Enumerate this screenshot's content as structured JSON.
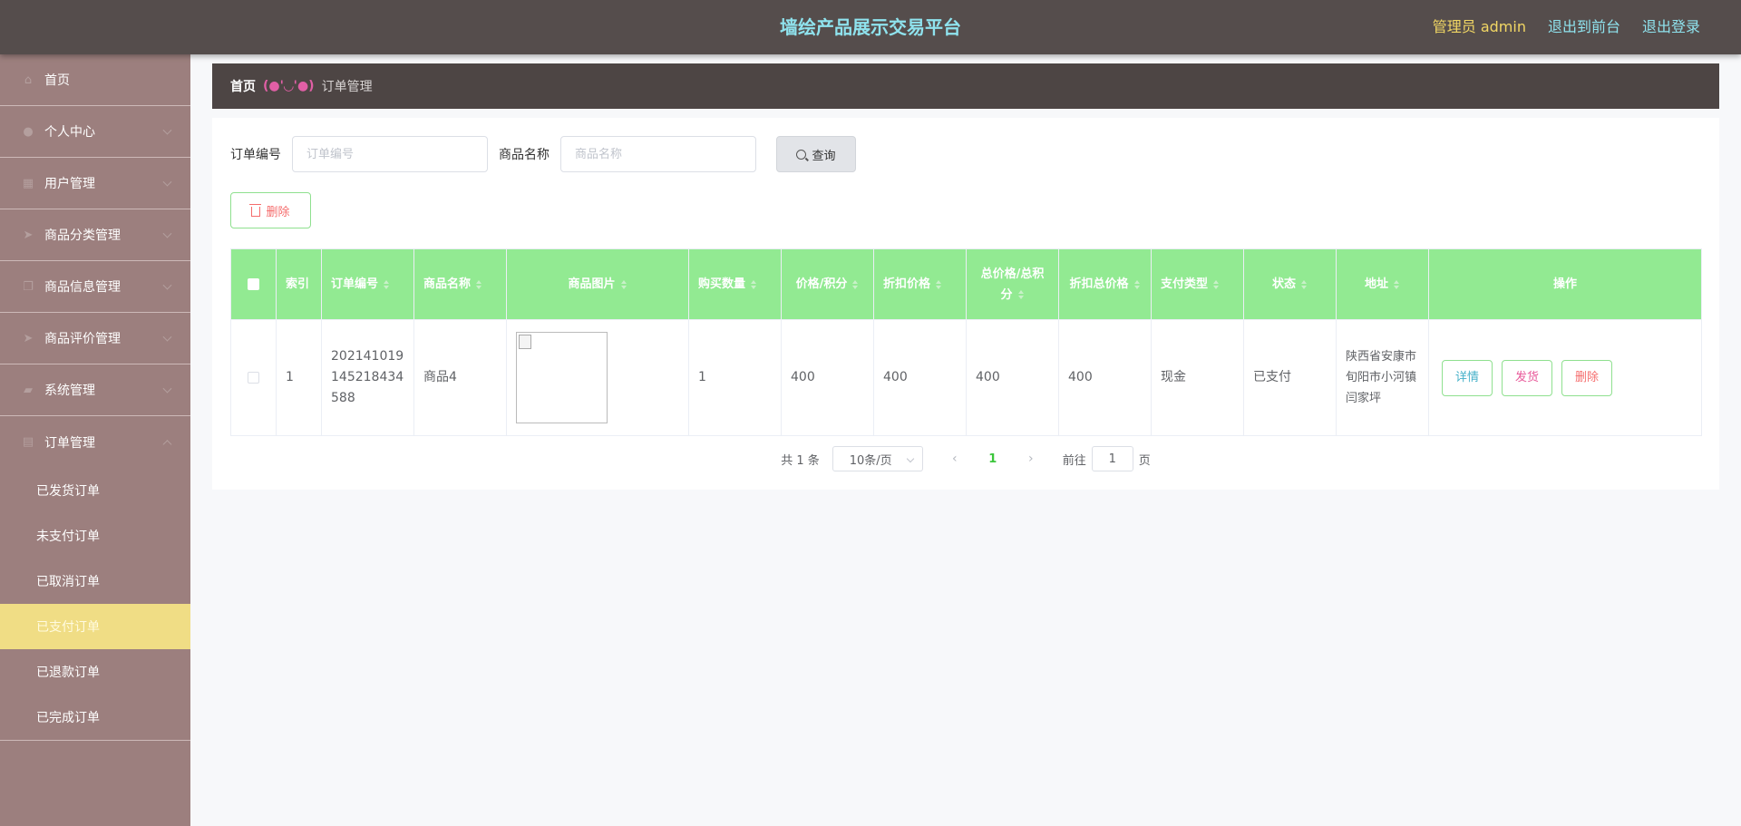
{
  "header": {
    "title": "墙绘产品展示交易平台",
    "admin_label": "管理员 admin",
    "to_front": "退出到前台",
    "logout": "退出登录"
  },
  "sidebar": {
    "items": [
      {
        "label": "首页",
        "icon": "home-icon"
      },
      {
        "label": "个人中心",
        "icon": "user-icon"
      },
      {
        "label": "用户管理",
        "icon": "grid-icon"
      },
      {
        "label": "商品分类管理",
        "icon": "send-icon"
      },
      {
        "label": "商品信息管理",
        "icon": "copy-icon"
      },
      {
        "label": "商品评价管理",
        "icon": "send-icon"
      },
      {
        "label": "系统管理",
        "icon": "truck-icon"
      },
      {
        "label": "订单管理",
        "icon": "cart-icon"
      }
    ],
    "sub_items": [
      "已发货订单",
      "未支付订单",
      "已取消订单",
      "已支付订单",
      "已退款订单",
      "已完成订单"
    ],
    "active_sub": "已支付订单"
  },
  "breadcrumb": {
    "home": "首页",
    "face": "(●'◡'●)",
    "current": "订单管理"
  },
  "search": {
    "order_no_label": "订单编号",
    "order_no_placeholder": "订单编号",
    "product_label": "商品名称",
    "product_placeholder": "商品名称",
    "query_button": "查询"
  },
  "toolbar": {
    "delete_button": "删除"
  },
  "table": {
    "headers": [
      "索引",
      "订单编号",
      "商品名称",
      "商品图片",
      "购买数量",
      "价格/积分",
      "折扣价格",
      "总价格/总积分",
      "折扣总价格",
      "支付类型",
      "状态",
      "地址",
      "操作"
    ],
    "rows": [
      {
        "index": "1",
        "order_no": "202141019145218434588",
        "product": "商品4",
        "quantity": "1",
        "price": "400",
        "discount_price": "400",
        "total": "400",
        "discount_total": "400",
        "pay_type": "现金",
        "status": "已支付",
        "address": "陕西省安康市旬阳市小河镇闫家坪",
        "actions": {
          "detail": "详情",
          "ship": "发货",
          "remove": "删除"
        }
      }
    ]
  },
  "pagination": {
    "total_text": "共 1 条",
    "page_size": "10条/页",
    "current_page": "1",
    "goto_label": "前往",
    "goto_value": "1",
    "page_suffix": "页"
  },
  "colors": {
    "topbar": "#554d4c",
    "sidebar": "#9c7f7e",
    "active_sub": "#f0dd85",
    "table_header": "#92ea92",
    "title": "#8fe3ee"
  }
}
